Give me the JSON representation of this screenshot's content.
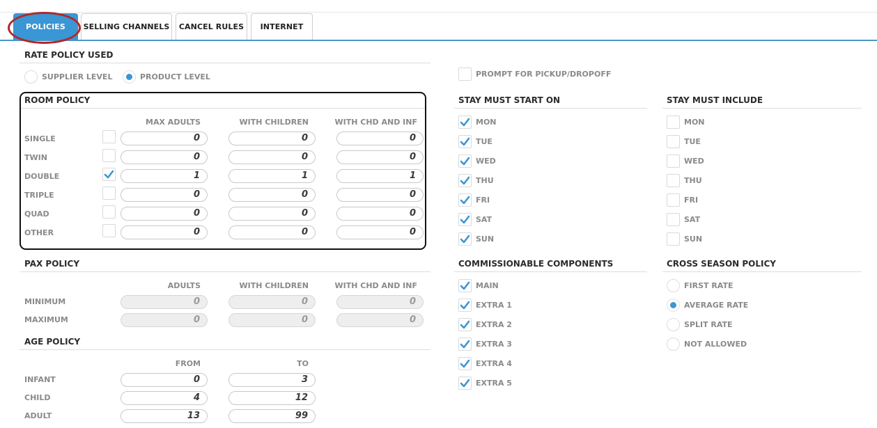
{
  "tabs": [
    "POLICIES",
    "SELLING CHANNELS",
    "CANCEL RULES",
    "INTERNET"
  ],
  "rate_policy": {
    "title": "RATE POLICY USED",
    "options": [
      "SUPPLIER LEVEL",
      "PRODUCT LEVEL"
    ],
    "selected": "PRODUCT LEVEL"
  },
  "prompt_pickup": {
    "label": "PROMPT FOR PICKUP/DROPOFF",
    "checked": false
  },
  "room_policy": {
    "title": "ROOM POLICY",
    "columns": [
      "MAX ADULTS",
      "WITH CHILDREN",
      "WITH CHD AND INF"
    ],
    "rows": [
      {
        "label": "SINGLE",
        "checked": false,
        "values": [
          "0",
          "0",
          "0"
        ]
      },
      {
        "label": "TWIN",
        "checked": false,
        "values": [
          "0",
          "0",
          "0"
        ]
      },
      {
        "label": "DOUBLE",
        "checked": true,
        "values": [
          "1",
          "1",
          "1"
        ]
      },
      {
        "label": "TRIPLE",
        "checked": false,
        "values": [
          "0",
          "0",
          "0"
        ]
      },
      {
        "label": "QUAD",
        "checked": false,
        "values": [
          "0",
          "0",
          "0"
        ]
      },
      {
        "label": "OTHER",
        "checked": false,
        "values": [
          "0",
          "0",
          "0"
        ]
      }
    ]
  },
  "pax_policy": {
    "title": "PAX POLICY",
    "columns": [
      "ADULTS",
      "WITH CHILDREN",
      "WITH CHD AND INF"
    ],
    "rows": [
      {
        "label": "MINIMUM",
        "values": [
          "0",
          "0",
          "0"
        ]
      },
      {
        "label": "MAXIMUM",
        "values": [
          "0",
          "0",
          "0"
        ]
      }
    ]
  },
  "age_policy": {
    "title": "AGE POLICY",
    "columns": [
      "FROM",
      "TO"
    ],
    "rows": [
      {
        "label": "INFANT",
        "values": [
          "0",
          "3"
        ]
      },
      {
        "label": "CHILD",
        "values": [
          "4",
          "12"
        ]
      },
      {
        "label": "ADULT",
        "values": [
          "13",
          "99"
        ]
      }
    ]
  },
  "stay_start": {
    "title": "STAY MUST START ON",
    "days": [
      {
        "label": "MON",
        "checked": true
      },
      {
        "label": "TUE",
        "checked": true
      },
      {
        "label": "WED",
        "checked": true
      },
      {
        "label": "THU",
        "checked": true
      },
      {
        "label": "FRI",
        "checked": true
      },
      {
        "label": "SAT",
        "checked": true
      },
      {
        "label": "SUN",
        "checked": true
      }
    ]
  },
  "stay_include": {
    "title": "STAY MUST INCLUDE",
    "days": [
      {
        "label": "MON",
        "checked": false
      },
      {
        "label": "TUE",
        "checked": false
      },
      {
        "label": "WED",
        "checked": false
      },
      {
        "label": "THU",
        "checked": false
      },
      {
        "label": "FRI",
        "checked": false
      },
      {
        "label": "SAT",
        "checked": false
      },
      {
        "label": "SUN",
        "checked": false
      }
    ]
  },
  "commissionable": {
    "title": "COMMISSIONABLE COMPONENTS",
    "items": [
      {
        "label": "MAIN",
        "checked": true
      },
      {
        "label": "EXTRA 1",
        "checked": true
      },
      {
        "label": "EXTRA 2",
        "checked": true
      },
      {
        "label": "EXTRA 3",
        "checked": true
      },
      {
        "label": "EXTRA 4",
        "checked": true
      },
      {
        "label": "EXTRA 5",
        "checked": true
      }
    ]
  },
  "cross_season": {
    "title": "CROSS SEASON POLICY",
    "options": [
      "FIRST RATE",
      "AVERAGE RATE",
      "SPLIT RATE",
      "NOT ALLOWED"
    ],
    "selected": "AVERAGE RATE"
  },
  "colors": {
    "accent": "#3a96d4",
    "highlight_ring": "#b02828"
  }
}
